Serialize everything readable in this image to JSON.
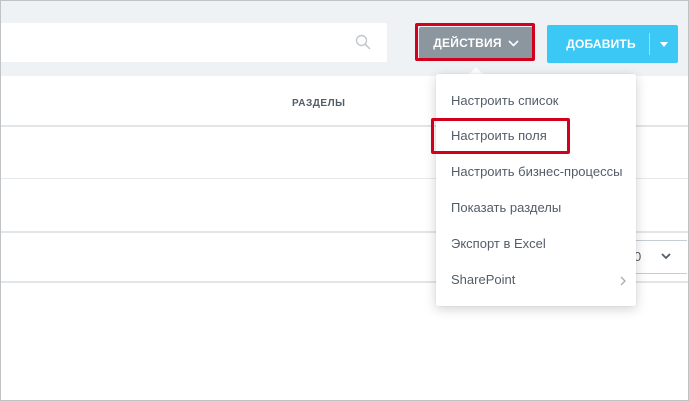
{
  "toolbar": {
    "search_placeholder": "",
    "actions_label": "ДЕЙСТВИЯ",
    "add_label": "ДОБАВИТЬ"
  },
  "grid": {
    "column_header": "РАЗДЕЛЫ"
  },
  "pager": {
    "page_size_partial": "0"
  },
  "actions_menu": {
    "items": [
      {
        "label": "Настроить список"
      },
      {
        "label": "Настроить поля"
      },
      {
        "label": "Настроить бизнес-процессы"
      },
      {
        "label": "Показать разделы"
      },
      {
        "label": "Экспорт в Excel"
      },
      {
        "label": "SharePoint"
      }
    ]
  },
  "colors": {
    "actions_button": "#8b969e",
    "add_button": "#3bc8f5",
    "highlight": "#d2001c",
    "text": "#535c69"
  },
  "icons": {
    "search": "search-icon",
    "actions_dropdown": "chevron-down-icon",
    "add_dropdown": "caret-down-icon",
    "submenu": "chevron-right-icon"
  }
}
